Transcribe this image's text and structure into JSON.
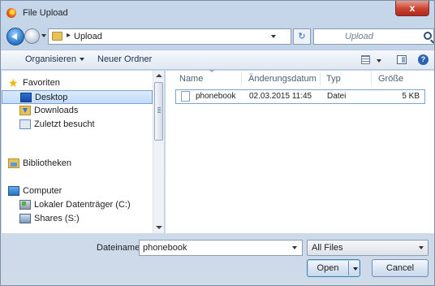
{
  "window": {
    "title": "File Upload",
    "close_label": "x"
  },
  "address": {
    "path_separator": "▸",
    "folder": "Upload",
    "refresh_glyph": "↻"
  },
  "search": {
    "placeholder": "Upload"
  },
  "toolbar": {
    "organize_label": "Organisieren",
    "new_folder_label": "Neuer Ordner",
    "help_label": "?"
  },
  "sidebar": {
    "items": [
      {
        "label": "Favoriten",
        "icon": "star-icon",
        "level": "top"
      },
      {
        "label": "Desktop",
        "icon": "desktop-icon",
        "level": "child",
        "selected": true
      },
      {
        "label": "Downloads",
        "icon": "downloads-icon",
        "level": "child"
      },
      {
        "label": "Zuletzt besucht",
        "icon": "recent-places-icon",
        "level": "child"
      },
      {
        "label": "Bibliotheken",
        "icon": "libraries-icon",
        "level": "top"
      },
      {
        "label": "Computer",
        "icon": "computer-icon",
        "level": "top"
      },
      {
        "label": "Lokaler Datenträger (C:)",
        "icon": "local-disk-icon",
        "level": "child"
      },
      {
        "label": "Shares (S:)",
        "icon": "network-share-icon",
        "level": "child"
      }
    ]
  },
  "file_list": {
    "columns": [
      "Name",
      "Änderungsdatum",
      "Typ",
      "Größe"
    ],
    "rows": [
      {
        "name": "phonebook",
        "modified": "02.03.2015 11:45",
        "type": "Datei",
        "size": "5 KB"
      }
    ]
  },
  "footer": {
    "filename_label": "Dateiname:",
    "filename_value": "phonebook",
    "filter_value": "All Files",
    "open_label": "Open",
    "cancel_label": "Cancel"
  }
}
